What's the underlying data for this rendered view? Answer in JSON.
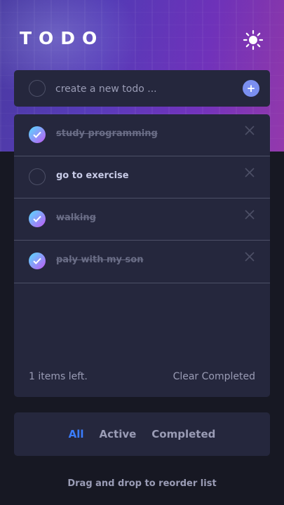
{
  "header": {
    "title": "TODO",
    "theme_icon": "sun-icon"
  },
  "create": {
    "placeholder": "create a new todo ...",
    "add_label": "+"
  },
  "todos": [
    {
      "text": "study programming",
      "completed": true
    },
    {
      "text": "go to exercise",
      "completed": false
    },
    {
      "text": "walking",
      "completed": true
    },
    {
      "text": "paly with my son",
      "completed": true
    }
  ],
  "footer": {
    "items_left": "1 items left.",
    "clear_label": "Clear Completed"
  },
  "filters": {
    "all": "All",
    "active": "Active",
    "completed": "Completed",
    "selected": "all"
  },
  "hint": "Drag and drop to reorder list",
  "colors": {
    "background": "#171823",
    "card": "#25273d",
    "accent": "#3a7cfd",
    "check_gradient_start": "#55ddff",
    "check_gradient_end": "#c058f3",
    "add_button": "#7b8ff0"
  }
}
